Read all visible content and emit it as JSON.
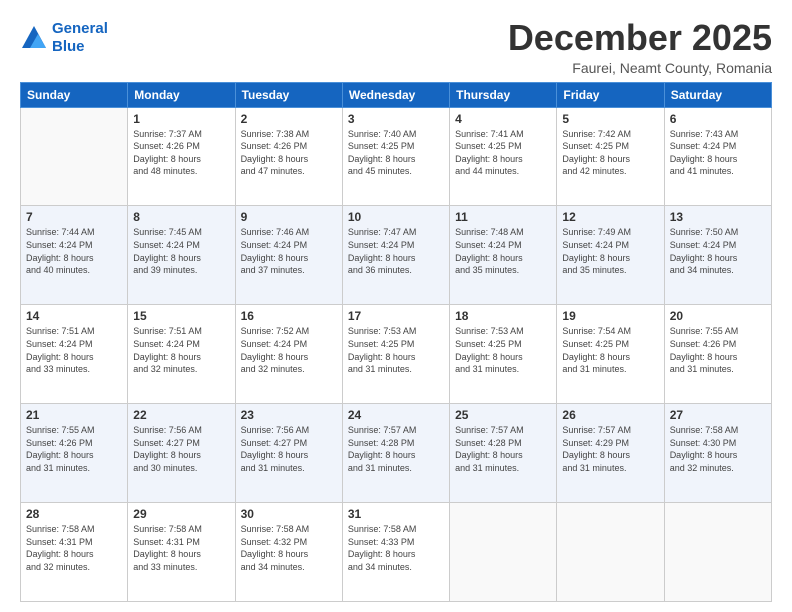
{
  "header": {
    "logo_line1": "General",
    "logo_line2": "Blue",
    "month_title": "December 2025",
    "location": "Faurei, Neamt County, Romania"
  },
  "weekdays": [
    "Sunday",
    "Monday",
    "Tuesday",
    "Wednesday",
    "Thursday",
    "Friday",
    "Saturday"
  ],
  "weeks": [
    [
      {
        "day": "",
        "info": ""
      },
      {
        "day": "1",
        "info": "Sunrise: 7:37 AM\nSunset: 4:26 PM\nDaylight: 8 hours\nand 48 minutes."
      },
      {
        "day": "2",
        "info": "Sunrise: 7:38 AM\nSunset: 4:26 PM\nDaylight: 8 hours\nand 47 minutes."
      },
      {
        "day": "3",
        "info": "Sunrise: 7:40 AM\nSunset: 4:25 PM\nDaylight: 8 hours\nand 45 minutes."
      },
      {
        "day": "4",
        "info": "Sunrise: 7:41 AM\nSunset: 4:25 PM\nDaylight: 8 hours\nand 44 minutes."
      },
      {
        "day": "5",
        "info": "Sunrise: 7:42 AM\nSunset: 4:25 PM\nDaylight: 8 hours\nand 42 minutes."
      },
      {
        "day": "6",
        "info": "Sunrise: 7:43 AM\nSunset: 4:24 PM\nDaylight: 8 hours\nand 41 minutes."
      }
    ],
    [
      {
        "day": "7",
        "info": "Sunrise: 7:44 AM\nSunset: 4:24 PM\nDaylight: 8 hours\nand 40 minutes."
      },
      {
        "day": "8",
        "info": "Sunrise: 7:45 AM\nSunset: 4:24 PM\nDaylight: 8 hours\nand 39 minutes."
      },
      {
        "day": "9",
        "info": "Sunrise: 7:46 AM\nSunset: 4:24 PM\nDaylight: 8 hours\nand 37 minutes."
      },
      {
        "day": "10",
        "info": "Sunrise: 7:47 AM\nSunset: 4:24 PM\nDaylight: 8 hours\nand 36 minutes."
      },
      {
        "day": "11",
        "info": "Sunrise: 7:48 AM\nSunset: 4:24 PM\nDaylight: 8 hours\nand 35 minutes."
      },
      {
        "day": "12",
        "info": "Sunrise: 7:49 AM\nSunset: 4:24 PM\nDaylight: 8 hours\nand 35 minutes."
      },
      {
        "day": "13",
        "info": "Sunrise: 7:50 AM\nSunset: 4:24 PM\nDaylight: 8 hours\nand 34 minutes."
      }
    ],
    [
      {
        "day": "14",
        "info": "Sunrise: 7:51 AM\nSunset: 4:24 PM\nDaylight: 8 hours\nand 33 minutes."
      },
      {
        "day": "15",
        "info": "Sunrise: 7:51 AM\nSunset: 4:24 PM\nDaylight: 8 hours\nand 32 minutes."
      },
      {
        "day": "16",
        "info": "Sunrise: 7:52 AM\nSunset: 4:24 PM\nDaylight: 8 hours\nand 32 minutes."
      },
      {
        "day": "17",
        "info": "Sunrise: 7:53 AM\nSunset: 4:25 PM\nDaylight: 8 hours\nand 31 minutes."
      },
      {
        "day": "18",
        "info": "Sunrise: 7:53 AM\nSunset: 4:25 PM\nDaylight: 8 hours\nand 31 minutes."
      },
      {
        "day": "19",
        "info": "Sunrise: 7:54 AM\nSunset: 4:25 PM\nDaylight: 8 hours\nand 31 minutes."
      },
      {
        "day": "20",
        "info": "Sunrise: 7:55 AM\nSunset: 4:26 PM\nDaylight: 8 hours\nand 31 minutes."
      }
    ],
    [
      {
        "day": "21",
        "info": "Sunrise: 7:55 AM\nSunset: 4:26 PM\nDaylight: 8 hours\nand 31 minutes."
      },
      {
        "day": "22",
        "info": "Sunrise: 7:56 AM\nSunset: 4:27 PM\nDaylight: 8 hours\nand 30 minutes."
      },
      {
        "day": "23",
        "info": "Sunrise: 7:56 AM\nSunset: 4:27 PM\nDaylight: 8 hours\nand 31 minutes."
      },
      {
        "day": "24",
        "info": "Sunrise: 7:57 AM\nSunset: 4:28 PM\nDaylight: 8 hours\nand 31 minutes."
      },
      {
        "day": "25",
        "info": "Sunrise: 7:57 AM\nSunset: 4:28 PM\nDaylight: 8 hours\nand 31 minutes."
      },
      {
        "day": "26",
        "info": "Sunrise: 7:57 AM\nSunset: 4:29 PM\nDaylight: 8 hours\nand 31 minutes."
      },
      {
        "day": "27",
        "info": "Sunrise: 7:58 AM\nSunset: 4:30 PM\nDaylight: 8 hours\nand 32 minutes."
      }
    ],
    [
      {
        "day": "28",
        "info": "Sunrise: 7:58 AM\nSunset: 4:31 PM\nDaylight: 8 hours\nand 32 minutes."
      },
      {
        "day": "29",
        "info": "Sunrise: 7:58 AM\nSunset: 4:31 PM\nDaylight: 8 hours\nand 33 minutes."
      },
      {
        "day": "30",
        "info": "Sunrise: 7:58 AM\nSunset: 4:32 PM\nDaylight: 8 hours\nand 34 minutes."
      },
      {
        "day": "31",
        "info": "Sunrise: 7:58 AM\nSunset: 4:33 PM\nDaylight: 8 hours\nand 34 minutes."
      },
      {
        "day": "",
        "info": ""
      },
      {
        "day": "",
        "info": ""
      },
      {
        "day": "",
        "info": ""
      }
    ]
  ]
}
